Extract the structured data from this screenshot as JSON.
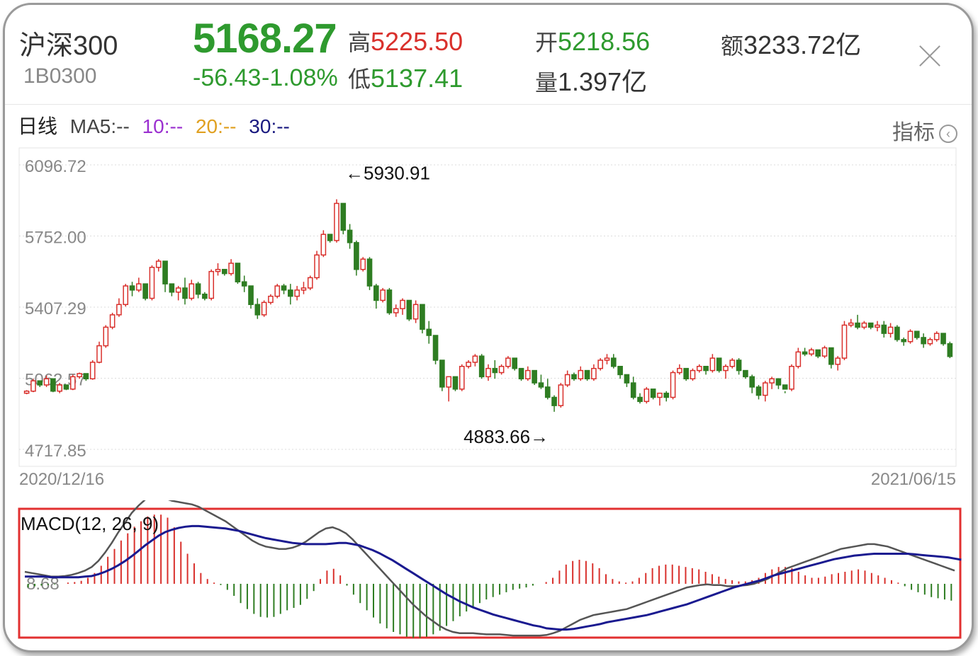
{
  "header": {
    "name": "沪深300",
    "code": "1B0300",
    "price": "5168.27",
    "change": "-56.43",
    "change_pct": "-1.08%",
    "high_label": "高",
    "high": "5225.50",
    "low_label": "低",
    "low": "5137.41",
    "open_label": "开",
    "open": "5218.56",
    "volume_label": "量",
    "volume": "1.397亿",
    "amount_label": "额",
    "amount": "3233.72亿"
  },
  "ma_row": {
    "period": "日线",
    "ma5": "MA5:--",
    "ma10": "10:--",
    "ma20": "20:--",
    "ma30": "30:--",
    "indicator_label": "指标",
    "indicator_icon": "chevron-left-circle-icon"
  },
  "colors": {
    "up": "#d9302c",
    "down": "#2e7d22",
    "ma5": "#444444",
    "ma10": "#9b30d0",
    "ma20": "#e0a020",
    "ma30": "#1a1a80",
    "macd_dif": "#555555",
    "macd_dea": "#1a1a90",
    "highlight_box": "#e23030"
  },
  "chart_data": [
    {
      "type": "candlestick",
      "y_ticks": [
        "6096.72",
        "5752.00",
        "5407.29",
        "5062.57",
        "4717.85"
      ],
      "ylim": [
        4717.85,
        6096.72
      ],
      "x_start_label": "2020/12/16",
      "x_end_label": "2021/06/15",
      "max_annotation": "←5930.91",
      "min_annotation": "4883.66→",
      "max_value": 5930.91,
      "min_value": 4883.66,
      "candles": [
        [
          4990,
          5005,
          4985,
          5000
        ],
        [
          5000,
          5060,
          4995,
          5050
        ],
        [
          5050,
          5045,
          5020,
          5030
        ],
        [
          5030,
          5075,
          5020,
          5060
        ],
        [
          5060,
          5020,
          4995,
          5000
        ],
        [
          5000,
          5040,
          4990,
          5030
        ],
        [
          5030,
          5025,
          5005,
          5010
        ],
        [
          5010,
          5080,
          5005,
          5070
        ],
        [
          5070,
          5090,
          5060,
          5085
        ],
        [
          5085,
          5080,
          5050,
          5060
        ],
        [
          5060,
          5150,
          5055,
          5140
        ],
        [
          5140,
          5240,
          5135,
          5220
        ],
        [
          5220,
          5320,
          5210,
          5310
        ],
        [
          5310,
          5380,
          5300,
          5370
        ],
        [
          5370,
          5450,
          5360,
          5420
        ],
        [
          5420,
          5520,
          5410,
          5510
        ],
        [
          5510,
          5530,
          5460,
          5490
        ],
        [
          5490,
          5550,
          5480,
          5520
        ],
        [
          5520,
          5500,
          5440,
          5450
        ],
        [
          5450,
          5610,
          5440,
          5600
        ],
        [
          5600,
          5640,
          5580,
          5630
        ],
        [
          5630,
          5570,
          5480,
          5520
        ],
        [
          5520,
          5510,
          5460,
          5480
        ],
        [
          5480,
          5510,
          5440,
          5500
        ],
        [
          5500,
          5550,
          5420,
          5450
        ],
        [
          5450,
          5540,
          5440,
          5520
        ],
        [
          5520,
          5530,
          5450,
          5470
        ],
        [
          5470,
          5480,
          5440,
          5450
        ],
        [
          5450,
          5590,
          5440,
          5580
        ],
        [
          5580,
          5620,
          5560,
          5590
        ],
        [
          5590,
          5580,
          5560,
          5570
        ],
        [
          5570,
          5640,
          5560,
          5620
        ],
        [
          5620,
          5600,
          5520,
          5530
        ],
        [
          5530,
          5560,
          5480,
          5510
        ],
        [
          5510,
          5500,
          5400,
          5420
        ],
        [
          5420,
          5450,
          5350,
          5370
        ],
        [
          5370,
          5440,
          5360,
          5430
        ],
        [
          5430,
          5470,
          5420,
          5460
        ],
        [
          5460,
          5520,
          5450,
          5510
        ],
        [
          5510,
          5520,
          5470,
          5490
        ],
        [
          5490,
          5520,
          5420,
          5460
        ],
        [
          5460,
          5510,
          5440,
          5490
        ],
        [
          5490,
          5530,
          5470,
          5500
        ],
        [
          5500,
          5560,
          5490,
          5550
        ],
        [
          5550,
          5680,
          5540,
          5660
        ],
        [
          5660,
          5780,
          5650,
          5760
        ],
        [
          5760,
          5760,
          5720,
          5730
        ],
        [
          5730,
          5930,
          5720,
          5910
        ],
        [
          5910,
          5870,
          5760,
          5780
        ],
        [
          5780,
          5810,
          5690,
          5720
        ],
        [
          5720,
          5730,
          5560,
          5590
        ],
        [
          5590,
          5650,
          5580,
          5640
        ],
        [
          5640,
          5650,
          5490,
          5510
        ],
        [
          5510,
          5520,
          5400,
          5440
        ],
        [
          5440,
          5500,
          5430,
          5490
        ],
        [
          5490,
          5500,
          5370,
          5380
        ],
        [
          5380,
          5420,
          5360,
          5400
        ],
        [
          5400,
          5450,
          5370,
          5440
        ],
        [
          5440,
          5420,
          5340,
          5350
        ],
        [
          5350,
          5440,
          5330,
          5420
        ],
        [
          5420,
          5390,
          5280,
          5300
        ],
        [
          5300,
          5340,
          5230,
          5270
        ],
        [
          5270,
          5270,
          5130,
          5150
        ],
        [
          5150,
          5150,
          5000,
          5020
        ],
        [
          5020,
          5060,
          4950,
          5070
        ],
        [
          5070,
          5020,
          5000,
          5010
        ],
        [
          5010,
          5130,
          5000,
          5120
        ],
        [
          5120,
          5150,
          5110,
          5140
        ],
        [
          5140,
          5180,
          5120,
          5170
        ],
        [
          5170,
          5180,
          5060,
          5070
        ],
        [
          5070,
          5130,
          5050,
          5110
        ],
        [
          5110,
          5150,
          5060,
          5090
        ],
        [
          5090,
          5130,
          5080,
          5120
        ],
        [
          5120,
          5170,
          5110,
          5160
        ],
        [
          5160,
          5160,
          5100,
          5110
        ],
        [
          5110,
          5080,
          5050,
          5060
        ],
        [
          5060,
          5120,
          5050,
          5100
        ],
        [
          5100,
          5100,
          5030,
          5040
        ],
        [
          5040,
          5080,
          5010,
          5020
        ],
        [
          5020,
          5060,
          4960,
          4970
        ],
        [
          4970,
          4980,
          4900,
          4930
        ],
        [
          4930,
          5040,
          4920,
          5030
        ],
        [
          5030,
          5100,
          5020,
          5080
        ],
        [
          5080,
          5090,
          5050,
          5060
        ],
        [
          5060,
          5120,
          5050,
          5100
        ],
        [
          5100,
          5090,
          5050,
          5060
        ],
        [
          5060,
          5130,
          5050,
          5110
        ],
        [
          5110,
          5160,
          5100,
          5150
        ],
        [
          5150,
          5180,
          5130,
          5160
        ],
        [
          5160,
          5180,
          5110,
          5120
        ],
        [
          5120,
          5120,
          5060,
          5080
        ],
        [
          5080,
          5080,
          5020,
          5040
        ],
        [
          5040,
          5070,
          4960,
          4970
        ],
        [
          4970,
          4990,
          4940,
          4950
        ],
        [
          4950,
          5020,
          4940,
          5010
        ],
        [
          5010,
          5010,
          4960,
          4970
        ],
        [
          4970,
          4990,
          4930,
          4990
        ],
        [
          4990,
          5000,
          4950,
          4970
        ],
        [
          4970,
          5100,
          4960,
          5090
        ],
        [
          5090,
          5130,
          5080,
          5110
        ],
        [
          5110,
          5090,
          5050,
          5060
        ],
        [
          5060,
          5110,
          5050,
          5100
        ],
        [
          5100,
          5130,
          5090,
          5120
        ],
        [
          5120,
          5110,
          5080,
          5100
        ],
        [
          5100,
          5180,
          5090,
          5160
        ],
        [
          5160,
          5160,
          5090,
          5100
        ],
        [
          5100,
          5130,
          5060,
          5120
        ],
        [
          5120,
          5160,
          5110,
          5150
        ],
        [
          5150,
          5160,
          5080,
          5100
        ],
        [
          5100,
          5090,
          5060,
          5070
        ],
        [
          5070,
          5080,
          4990,
          5020
        ],
        [
          5020,
          5030,
          4960,
          4980
        ],
        [
          4980,
          5050,
          4950,
          5040
        ],
        [
          5040,
          5070,
          5010,
          5060
        ],
        [
          5060,
          5060,
          5010,
          5030
        ],
        [
          5030,
          5000,
          4990,
          5010
        ],
        [
          5010,
          5130,
          5000,
          5120
        ],
        [
          5120,
          5210,
          5110,
          5190
        ],
        [
          5190,
          5210,
          5170,
          5180
        ],
        [
          5180,
          5210,
          5170,
          5200
        ],
        [
          5200,
          5190,
          5160,
          5170
        ],
        [
          5170,
          5220,
          5160,
          5210
        ],
        [
          5210,
          5190,
          5110,
          5130
        ],
        [
          5130,
          5170,
          5100,
          5160
        ],
        [
          5160,
          5340,
          5150,
          5320
        ],
        [
          5320,
          5350,
          5310,
          5330
        ],
        [
          5330,
          5370,
          5300,
          5310
        ],
        [
          5310,
          5340,
          5300,
          5330
        ],
        [
          5330,
          5320,
          5300,
          5310
        ],
        [
          5310,
          5340,
          5290,
          5320
        ],
        [
          5320,
          5340,
          5260,
          5280
        ],
        [
          5280,
          5330,
          5260,
          5310
        ],
        [
          5310,
          5320,
          5240,
          5250
        ],
        [
          5250,
          5260,
          5220,
          5240
        ],
        [
          5240,
          5300,
          5230,
          5290
        ],
        [
          5290,
          5280,
          5250,
          5260
        ],
        [
          5260,
          5280,
          5210,
          5230
        ],
        [
          5230,
          5260,
          5220,
          5250
        ],
        [
          5250,
          5290,
          5240,
          5280
        ],
        [
          5280,
          5270,
          5220,
          5230
        ],
        [
          5230,
          5240,
          5160,
          5168
        ]
      ]
    },
    {
      "type": "macd",
      "title": "MACD(12, 26, 9)",
      "zero_label": "8.68",
      "histogram": [
        -6,
        -4,
        -3,
        -2,
        -1,
        0,
        2,
        3,
        5,
        10,
        18,
        30,
        45,
        58,
        72,
        84,
        95,
        104,
        112,
        115,
        115,
        110,
        94,
        70,
        50,
        34,
        18,
        8,
        2,
        -2,
        -10,
        -20,
        -32,
        -42,
        -50,
        -55,
        -56,
        -55,
        -50,
        -44,
        -40,
        -35,
        -25,
        -12,
        8,
        22,
        25,
        14,
        -3,
        -18,
        -32,
        -44,
        -56,
        -66,
        -74,
        -80,
        -84,
        -88,
        -90,
        -90,
        -88,
        -84,
        -78,
        -70,
        -62,
        -54,
        -46,
        -38,
        -32,
        -26,
        -22,
        -18,
        -14,
        -10,
        -8,
        -6,
        -3,
        0,
        3,
        10,
        22,
        32,
        38,
        40,
        38,
        34,
        26,
        16,
        8,
        4,
        2,
        4,
        10,
        18,
        26,
        30,
        32,
        32,
        30,
        28,
        26,
        24,
        20,
        16,
        12,
        8,
        6,
        4,
        4,
        6,
        10,
        18,
        24,
        28,
        28,
        26,
        20,
        14,
        10,
        10,
        12,
        16,
        18,
        20,
        22,
        24,
        22,
        18,
        14,
        10,
        6,
        2,
        -4,
        -10,
        -14,
        -18,
        -22,
        -24,
        -26,
        -28
      ],
      "dif": [
        20,
        18,
        16,
        14,
        12,
        12,
        13,
        15,
        18,
        22,
        28,
        38,
        52,
        68,
        86,
        102,
        118,
        130,
        140,
        145,
        146,
        142,
        138,
        136,
        134,
        132,
        128,
        122,
        116,
        110,
        104,
        96,
        88,
        80,
        72,
        66,
        62,
        60,
        58,
        58,
        60,
        64,
        70,
        78,
        86,
        92,
        94,
        90,
        84,
        74,
        62,
        50,
        38,
        26,
        14,
        2,
        -10,
        -22,
        -34,
        -44,
        -54,
        -62,
        -70,
        -76,
        -80,
        -82,
        -82,
        -82,
        -83,
        -84,
        -84,
        -84,
        -85,
        -86,
        -86,
        -86,
        -86,
        -86,
        -85,
        -82,
        -78,
        -72,
        -66,
        -60,
        -56,
        -52,
        -50,
        -48,
        -46,
        -44,
        -42,
        -38,
        -34,
        -30,
        -26,
        -22,
        -18,
        -14,
        -10,
        -6,
        -4,
        -2,
        -1,
        -2,
        -2,
        -4,
        -4,
        -3,
        -2,
        0,
        4,
        8,
        14,
        20,
        26,
        30,
        34,
        38,
        42,
        46,
        50,
        54,
        58,
        60,
        62,
        64,
        66,
        66,
        64,
        62,
        58,
        54,
        50,
        46,
        42,
        38,
        34,
        30,
        26,
        22
      ],
      "dea": [
        12,
        12,
        12,
        12,
        11,
        11,
        11,
        11,
        11,
        12,
        13,
        16,
        20,
        25,
        31,
        38,
        46,
        55,
        64,
        72,
        80,
        86,
        90,
        93,
        95,
        96,
        96,
        95,
        94,
        93,
        92,
        90,
        88,
        85,
        82,
        79,
        76,
        74,
        72,
        70,
        68,
        67,
        66,
        66,
        66,
        66,
        67,
        68,
        68,
        66,
        64,
        60,
        56,
        51,
        45,
        39,
        32,
        25,
        18,
        11,
        4,
        -3,
        -10,
        -17,
        -23,
        -29,
        -34,
        -39,
        -43,
        -47,
        -51,
        -54,
        -57,
        -60,
        -63,
        -66,
        -69,
        -71,
        -74,
        -75,
        -76,
        -76,
        -75,
        -73,
        -71,
        -69,
        -67,
        -64,
        -62,
        -60,
        -58,
        -56,
        -54,
        -52,
        -49,
        -46,
        -43,
        -40,
        -37,
        -34,
        -30,
        -26,
        -22,
        -18,
        -14,
        -10,
        -6,
        -3,
        0,
        3,
        6,
        10,
        14,
        17,
        20,
        23,
        26,
        29,
        32,
        35,
        38,
        41,
        43,
        45,
        47,
        48,
        49,
        50,
        50,
        50,
        50,
        50,
        50,
        49,
        48,
        47,
        46,
        45,
        44,
        42,
        40
      ]
    }
  ]
}
